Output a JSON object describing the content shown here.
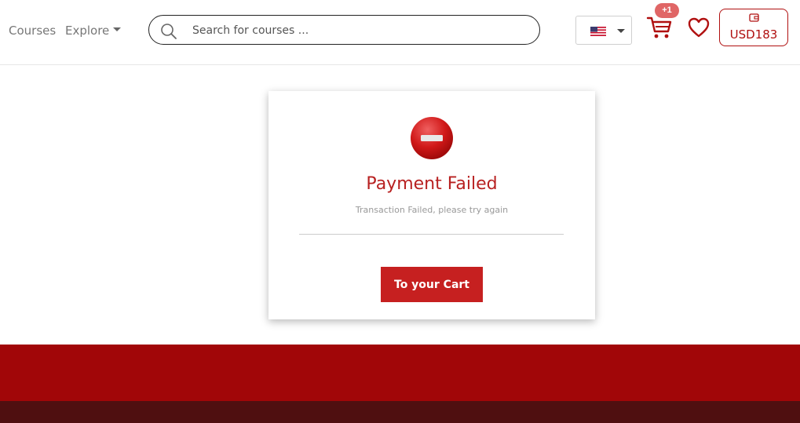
{
  "header": {
    "nav": [
      {
        "label": "Courses"
      },
      {
        "label": "Explore"
      }
    ],
    "search": {
      "placeholder": "Search for courses ..."
    },
    "language": {
      "flag": "us-flag-icon"
    },
    "cart": {
      "badge": "+1"
    },
    "wallet": {
      "amount": "USD183"
    }
  },
  "card": {
    "icon": "no-entry-icon",
    "title": "Payment Failed",
    "subtitle": "Transaction Failed, please try again",
    "button_label": "To your Cart"
  },
  "colors": {
    "brand": "#a10608",
    "accent": "#c62020",
    "footer_dark": "#4f0f10",
    "badge": "#e06666"
  }
}
